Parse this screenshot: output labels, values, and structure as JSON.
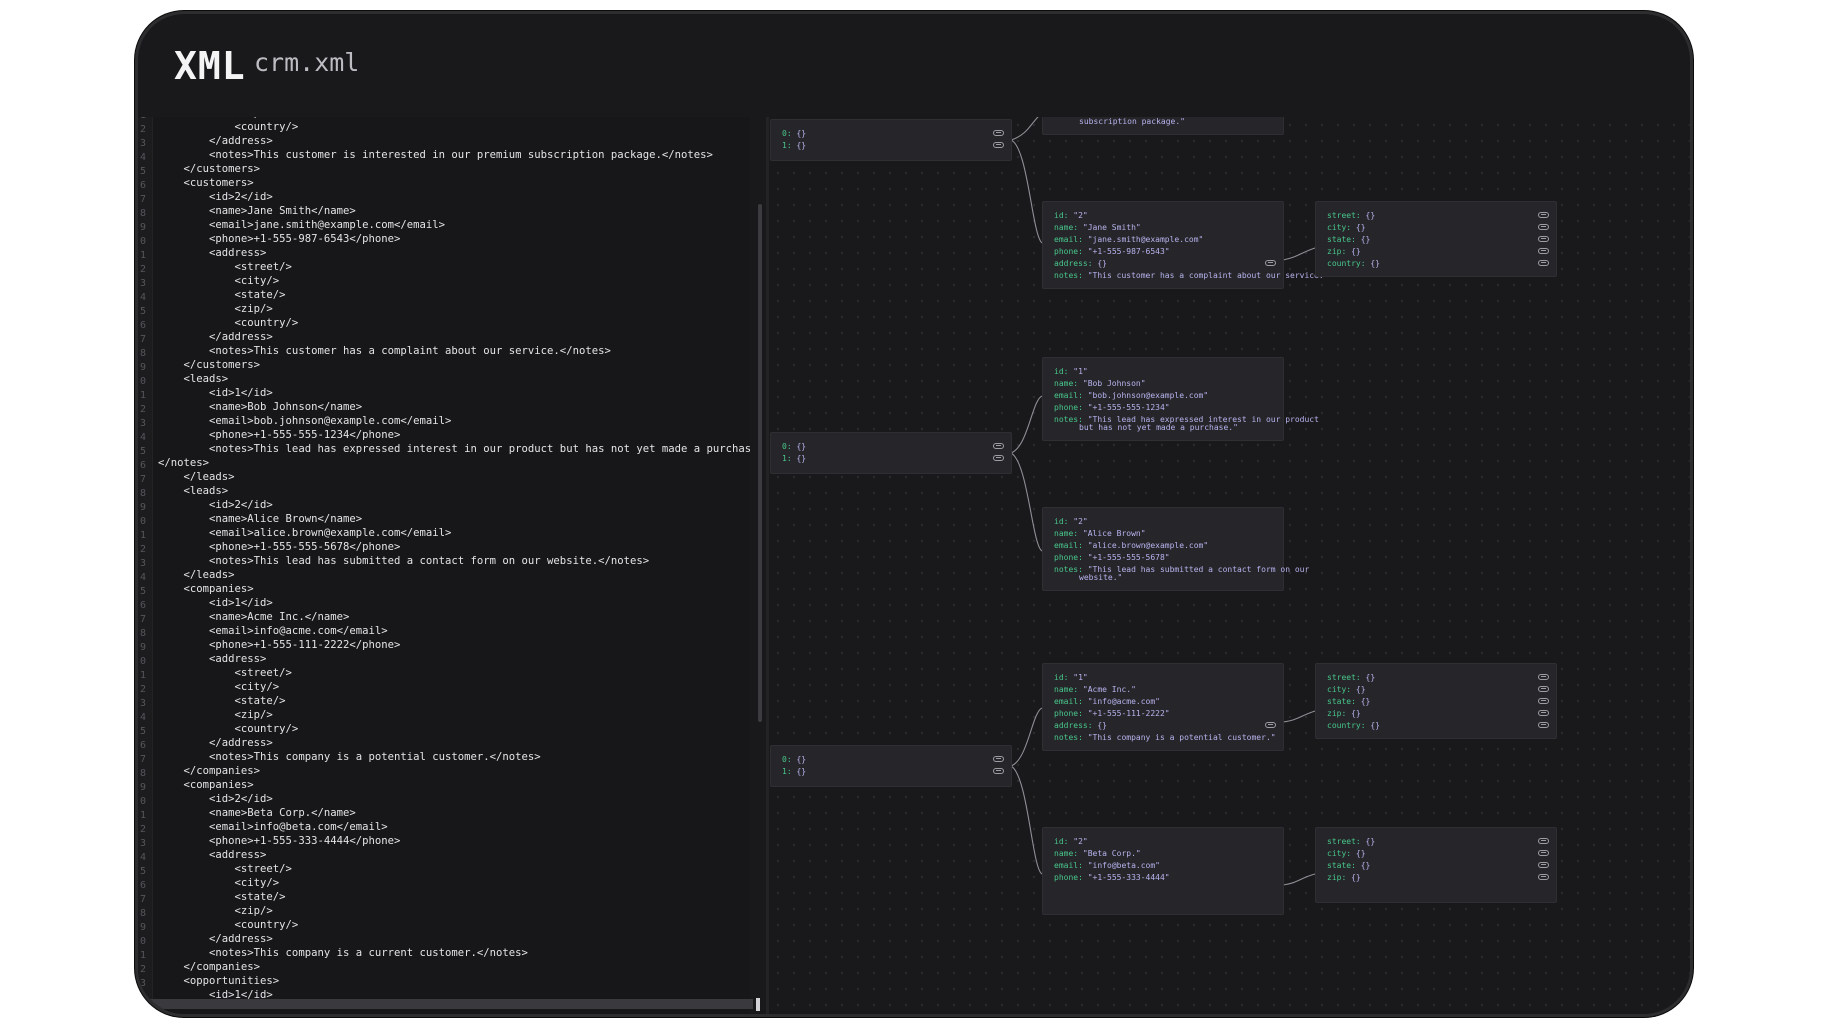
{
  "header": {
    "brand": "XML",
    "filename": "crm.xml"
  },
  "editor": {
    "lines": [
      "            <zip/>",
      "            <country/>",
      "        </address>",
      "        <notes>This customer is interested in our premium subscription package.</notes>",
      "    </customers>",
      "    <customers>",
      "        <id>2</id>",
      "        <name>Jane Smith</name>",
      "        <email>jane.smith@example.com</email>",
      "        <phone>+1-555-987-6543</phone>",
      "        <address>",
      "            <street/>",
      "            <city/>",
      "            <state/>",
      "            <zip/>",
      "            <country/>",
      "        </address>",
      "        <notes>This customer has a complaint about our service.</notes>",
      "    </customers>",
      "    <leads>",
      "        <id>1</id>",
      "        <name>Bob Johnson</name>",
      "        <email>bob.johnson@example.com</email>",
      "        <phone>+1-555-555-1234</phone>",
      "        <notes>This lead has expressed interest in our product but has not yet made a purchase.",
      "</notes>",
      "    </leads>",
      "    <leads>",
      "        <id>2</id>",
      "        <name>Alice Brown</name>",
      "        <email>alice.brown@example.com</email>",
      "        <phone>+1-555-555-5678</phone>",
      "        <notes>This lead has submitted a contact form on our website.</notes>",
      "    </leads>",
      "    <companies>",
      "        <id>1</id>",
      "        <name>Acme Inc.</name>",
      "        <email>info@acme.com</email>",
      "        <phone>+1-555-111-2222</phone>",
      "        <address>",
      "            <street/>",
      "            <city/>",
      "            <state/>",
      "            <zip/>",
      "            <country/>",
      "        </address>",
      "        <notes>This company is a potential customer.</notes>",
      "    </companies>",
      "    <companies>",
      "        <id>2</id>",
      "        <name>Beta Corp.</name>",
      "        <email>info@beta.com</email>",
      "        <phone>+1-555-333-4444</phone>",
      "        <address>",
      "            <street/>",
      "            <city/>",
      "            <state/>",
      "            <zip/>",
      "            <country/>",
      "        </address>",
      "        <notes>This company is a current customer.</notes>",
      "    </companies>",
      "    <opportunities>",
      "        <id>1</id>"
    ],
    "gutter_digits": [
      "1",
      "2",
      "3",
      "4",
      "5",
      "6",
      "7",
      "8",
      "9",
      "0",
      "1",
      "2",
      "3",
      "4",
      "5",
      "6",
      "7",
      "8",
      "9",
      "0",
      "1",
      "2",
      "3",
      "4",
      "5",
      "6",
      "7",
      "8",
      "9",
      "0",
      "1",
      "2",
      "3",
      "4",
      "5",
      "6",
      "7",
      "8",
      "9",
      "0",
      "1",
      "2",
      "3",
      "4",
      "5",
      "6",
      "7",
      "8",
      "9",
      "0",
      "1",
      "2",
      "3",
      "4",
      "5",
      "6",
      "7",
      "8",
      "9",
      "0",
      "1",
      "2",
      "3",
      "4"
    ]
  },
  "graph": {
    "customers_array": {
      "rows": [
        {
          "key": "0",
          "value": "{}"
        },
        {
          "key": "1",
          "value": "{}"
        }
      ]
    },
    "customer1_partial": {
      "continuation": "subscription package.\""
    },
    "customer2": {
      "rows": [
        {
          "key": "id",
          "value": "\"2\""
        },
        {
          "key": "name",
          "value": "\"Jane Smith\""
        },
        {
          "key": "email",
          "value": "\"jane.smith@example.com\""
        },
        {
          "key": "phone",
          "value": "\"+1-555-987-6543\""
        },
        {
          "key": "address",
          "value": "{}"
        },
        {
          "key": "notes",
          "value": "\"This customer has a complaint about our service.\""
        }
      ]
    },
    "customer2_address": {
      "rows": [
        {
          "key": "street",
          "value": "{}"
        },
        {
          "key": "city",
          "value": "{}"
        },
        {
          "key": "state",
          "value": "{}"
        },
        {
          "key": "zip",
          "value": "{}"
        },
        {
          "key": "country",
          "value": "{}"
        }
      ]
    },
    "leads_array": {
      "rows": [
        {
          "key": "0",
          "value": "{}"
        },
        {
          "key": "1",
          "value": "{}"
        }
      ]
    },
    "lead1": {
      "rows": [
        {
          "key": "id",
          "value": "\"1\""
        },
        {
          "key": "name",
          "value": "\"Bob Johnson\""
        },
        {
          "key": "email",
          "value": "\"bob.johnson@example.com\""
        },
        {
          "key": "phone",
          "value": "\"+1-555-555-1234\""
        },
        {
          "key": "notes",
          "value": "\"This lead has expressed interest in our product"
        }
      ],
      "continuation": "but has not yet made a purchase.\""
    },
    "lead2": {
      "rows": [
        {
          "key": "id",
          "value": "\"2\""
        },
        {
          "key": "name",
          "value": "\"Alice Brown\""
        },
        {
          "key": "email",
          "value": "\"alice.brown@example.com\""
        },
        {
          "key": "phone",
          "value": "\"+1-555-555-5678\""
        },
        {
          "key": "notes",
          "value": "\"This lead has submitted a contact form on our"
        }
      ],
      "continuation": "website.\""
    },
    "companies_array": {
      "rows": [
        {
          "key": "0",
          "value": "{}"
        },
        {
          "key": "1",
          "value": "{}"
        }
      ]
    },
    "company1": {
      "rows": [
        {
          "key": "id",
          "value": "\"1\""
        },
        {
          "key": "name",
          "value": "\"Acme Inc.\""
        },
        {
          "key": "email",
          "value": "\"info@acme.com\""
        },
        {
          "key": "phone",
          "value": "\"+1-555-111-2222\""
        },
        {
          "key": "address",
          "value": "{}"
        },
        {
          "key": "notes",
          "value": "\"This company is a potential customer.\""
        }
      ]
    },
    "company1_address": {
      "rows": [
        {
          "key": "street",
          "value": "{}"
        },
        {
          "key": "city",
          "value": "{}"
        },
        {
          "key": "state",
          "value": "{}"
        },
        {
          "key": "zip",
          "value": "{}"
        },
        {
          "key": "country",
          "value": "{}"
        }
      ]
    },
    "company2": {
      "rows": [
        {
          "key": "id",
          "value": "\"2\""
        },
        {
          "key": "name",
          "value": "\"Beta Corp.\""
        },
        {
          "key": "email",
          "value": "\"info@beta.com\""
        },
        {
          "key": "phone",
          "value": "\"+1-555-333-4444\""
        }
      ]
    },
    "company2_address": {
      "rows": [
        {
          "key": "street",
          "value": "{}"
        },
        {
          "key": "city",
          "value": "{}"
        },
        {
          "key": "state",
          "value": "{}"
        },
        {
          "key": "zip",
          "value": "{}"
        }
      ]
    }
  }
}
